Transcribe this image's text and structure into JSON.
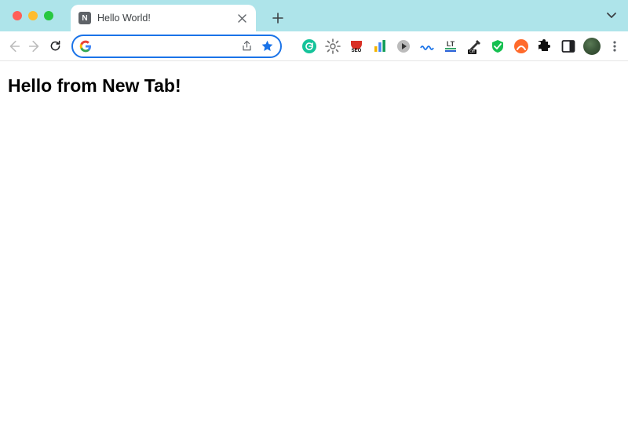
{
  "tabstrip": {
    "tab": {
      "favicon_letter": "N",
      "title": "Hello World!"
    }
  },
  "toolbar": {
    "omnibox_value": ""
  },
  "page": {
    "heading": "Hello from New Tab!"
  },
  "icons": {
    "search_prefix": "google-g"
  }
}
